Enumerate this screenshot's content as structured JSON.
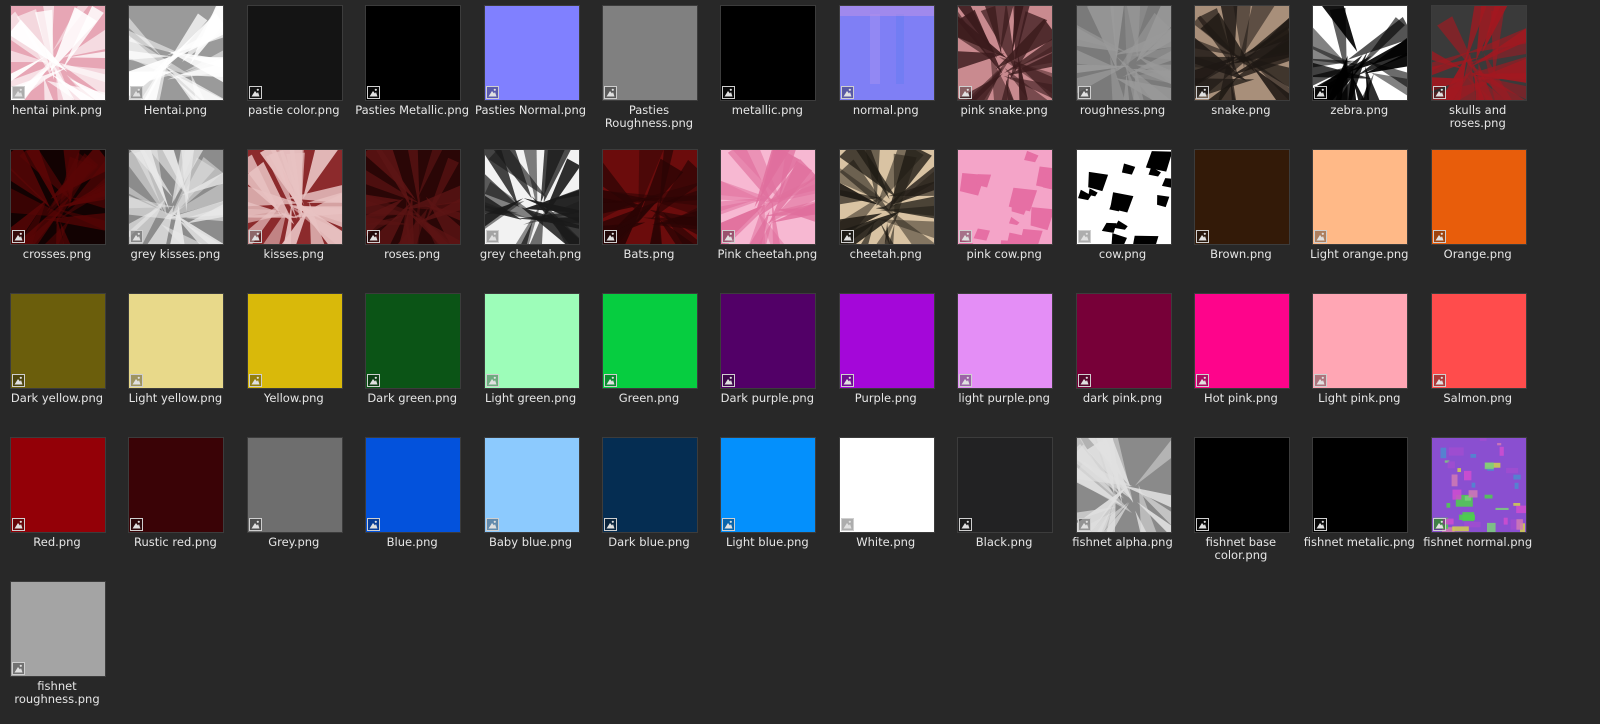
{
  "files": [
    {
      "name": "hentai pink.png",
      "color": "#e7a6b5",
      "pattern": "shards",
      "accent": "#ffffff"
    },
    {
      "name": "Hentai.png",
      "color": "#9a9a9a",
      "pattern": "shards",
      "accent": "#ffffff"
    },
    {
      "name": "pastie color.png",
      "color": "#141414"
    },
    {
      "name": "Pasties Metallic.png",
      "color": "#000000"
    },
    {
      "name": "Pasties Normal.png",
      "color": "#8080ff"
    },
    {
      "name": "Pasties Roughness.png",
      "color": "#808080"
    },
    {
      "name": "metallic.png",
      "color": "#000000"
    },
    {
      "name": "normal.png",
      "color": "#7f7ff5",
      "pattern": "normal",
      "accent": "#9a8cf2"
    },
    {
      "name": "pink snake.png",
      "color": "#c98a8f",
      "pattern": "shards",
      "accent": "#3a1a1c"
    },
    {
      "name": "roughness.png",
      "color": "#7a7a7a",
      "pattern": "shards",
      "accent": "#9a9a9a"
    },
    {
      "name": "snake.png",
      "color": "#a88f7a",
      "pattern": "shards",
      "accent": "#1e1814"
    },
    {
      "name": "zebra.png",
      "color": "#ffffff",
      "pattern": "shards",
      "accent": "#000000"
    },
    {
      "name": "skulls and roses.png",
      "color": "#3a3a3a",
      "pattern": "shards",
      "accent": "#a31820"
    },
    {
      "name": "crosses.png",
      "color": "#120202",
      "pattern": "shards",
      "accent": "#5a0606"
    },
    {
      "name": "grey kisses.png",
      "color": "#8c8c8c",
      "pattern": "shards",
      "accent": "#e8e8e8"
    },
    {
      "name": "kisses.png",
      "color": "#8c2a2c",
      "pattern": "shards",
      "accent": "#e8c2c2"
    },
    {
      "name": "roses.png",
      "color": "#2a0606",
      "pattern": "shards",
      "accent": "#5c1414"
    },
    {
      "name": "grey cheetah.png",
      "color": "#f2f2f2",
      "pattern": "shards",
      "accent": "#1a1a1a"
    },
    {
      "name": "Bats.png",
      "color": "#6b0c0c",
      "pattern": "shards",
      "accent": "#2a0404"
    },
    {
      "name": "Pink cheetah.png",
      "color": "#f7b8d2",
      "pattern": "shards",
      "accent": "#e06f9d"
    },
    {
      "name": "cheetah.png",
      "color": "#d9c3a3",
      "pattern": "shards",
      "accent": "#1e1a14"
    },
    {
      "name": "pink cow.png",
      "color": "#f4a4c8",
      "pattern": "patches",
      "accent": "#e66fa4"
    },
    {
      "name": "cow.png",
      "color": "#ffffff",
      "pattern": "patches",
      "accent": "#000000"
    },
    {
      "name": "Brown.png",
      "color": "#331a08"
    },
    {
      "name": "Light orange.png",
      "color": "#ffb987"
    },
    {
      "name": "Orange.png",
      "color": "#e85d0b"
    },
    {
      "name": "Dark yellow.png",
      "color": "#6b5e0c"
    },
    {
      "name": "Light yellow.png",
      "color": "#e8d98a"
    },
    {
      "name": "Yellow.png",
      "color": "#d9b90a"
    },
    {
      "name": "Dark green.png",
      "color": "#0b5416"
    },
    {
      "name": "Light green.png",
      "color": "#9dfdb9"
    },
    {
      "name": "Green.png",
      "color": "#06cd40"
    },
    {
      "name": "Dark purple.png",
      "color": "#520067"
    },
    {
      "name": "Purple.png",
      "color": "#a407d9"
    },
    {
      "name": "light purple.png",
      "color": "#e48ef6"
    },
    {
      "name": "dark pink.png",
      "color": "#770038"
    },
    {
      "name": "Hot pink.png",
      "color": "#fe048b"
    },
    {
      "name": "Light pink.png",
      "color": "#ffa6b4"
    },
    {
      "name": "Salmon.png",
      "color": "#ff4c4c"
    },
    {
      "name": "Red.png",
      "color": "#930007"
    },
    {
      "name": "Rustic red.png",
      "color": "#3a0306"
    },
    {
      "name": "Grey.png",
      "color": "#6e6e6e"
    },
    {
      "name": "Blue.png",
      "color": "#0352dc"
    },
    {
      "name": "Baby blue.png",
      "color": "#8ccafe"
    },
    {
      "name": "Dark blue.png",
      "color": "#052d52"
    },
    {
      "name": "Light blue.png",
      "color": "#0490fc"
    },
    {
      "name": "White.png",
      "color": "#ffffff"
    },
    {
      "name": "Black.png",
      "color": "#222223"
    },
    {
      "name": "fishnet alpha.png",
      "color": "#8a8a8a",
      "pattern": "shards",
      "accent": "#e0e0e0"
    },
    {
      "name": "fishnet base color.png",
      "color": "#000000"
    },
    {
      "name": "fishnet metalic.png",
      "color": "#000000"
    },
    {
      "name": "fishnet normal.png",
      "color": "#8a4fd0",
      "pattern": "rainbow",
      "accent": "#4cd04c"
    },
    {
      "name": "fishnet roughness.png",
      "color": "#a4a4a4"
    }
  ]
}
